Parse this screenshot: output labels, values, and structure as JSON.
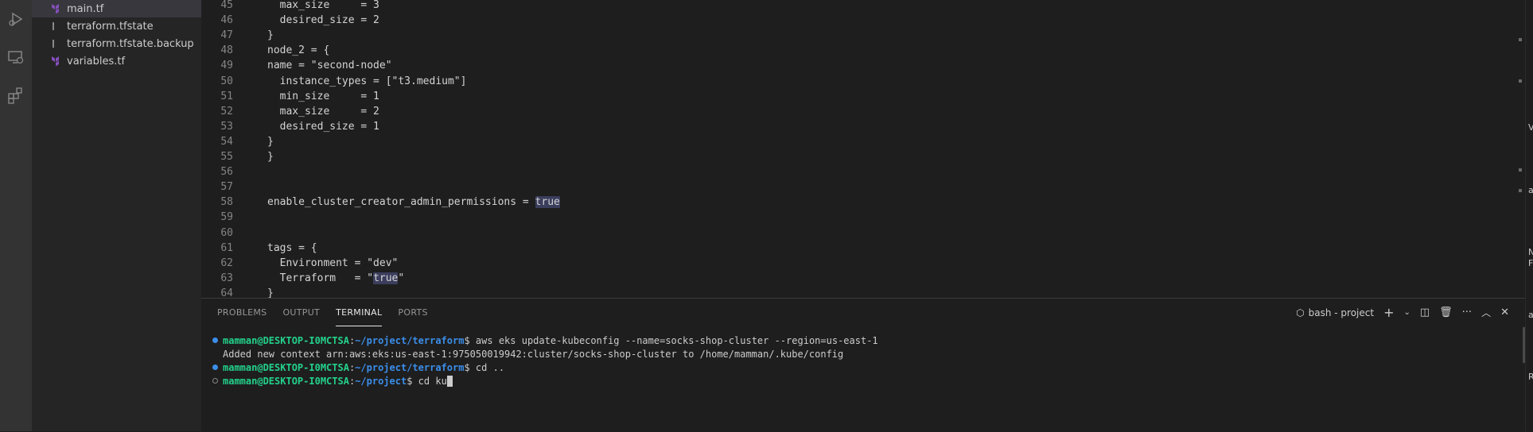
{
  "files": [
    {
      "name": "main.tf",
      "icon": "terraform-icon",
      "active": true
    },
    {
      "name": "terraform.tfstate",
      "icon": "file-lines-icon",
      "active": false
    },
    {
      "name": "terraform.tfstate.backup",
      "icon": "file-lines-icon",
      "active": false
    },
    {
      "name": "variables.tf",
      "icon": "terraform-icon",
      "active": false
    }
  ],
  "editor": {
    "lines": [
      {
        "n": "45",
        "text": "  max_size     = 3"
      },
      {
        "n": "46",
        "text": "  desired_size = 2"
      },
      {
        "n": "47",
        "text": "}"
      },
      {
        "n": "48",
        "text": "node_2 = {"
      },
      {
        "n": "49",
        "text": "name = \"second-node\""
      },
      {
        "n": "50",
        "text": "  instance_types = [\"t3.medium\"]"
      },
      {
        "n": "51",
        "text": "  min_size     = 1"
      },
      {
        "n": "52",
        "text": "  max_size     = 2"
      },
      {
        "n": "53",
        "text": "  desired_size = 1"
      },
      {
        "n": "54",
        "text": "}"
      },
      {
        "n": "55",
        "text": "}"
      },
      {
        "n": "56",
        "text": ""
      },
      {
        "n": "57",
        "text": ""
      },
      {
        "n": "58",
        "text": "enable_cluster_creator_admin_permissions = ",
        "hl": "true"
      },
      {
        "n": "59",
        "text": ""
      },
      {
        "n": "60",
        "text": ""
      },
      {
        "n": "61",
        "text": "tags = {"
      },
      {
        "n": "62",
        "text": "  Environment = \"dev\""
      },
      {
        "n": "63",
        "text": "  Terraform   = \"",
        "hl": "true",
        "after": "\""
      },
      {
        "n": "64",
        "text": "}"
      }
    ]
  },
  "panel": {
    "tabs": [
      "PROBLEMS",
      "OUTPUT",
      "TERMINAL",
      "PORTS"
    ],
    "active_tab": "TERMINAL",
    "terminal_name": "bash - project"
  },
  "terminal": {
    "lines": [
      {
        "user": "mamman@DESKTOP-I0MCTSA",
        "path": "~/project/terraform",
        "cmd": " aws eks update-kubeconfig --name=socks-shop-cluster --region=us-east-1",
        "dot": "#3b8eea"
      },
      {
        "output": "Added new context arn:aws:eks:us-east-1:975050019942:cluster/socks-shop-cluster to /home/mamman/.kube/config"
      },
      {
        "user": "mamman@DESKTOP-I0MCTSA",
        "path": "~/project/terraform",
        "cmd": " cd ..",
        "dot": "#3b8eea"
      },
      {
        "user": "mamman@DESKTOP-I0MCTSA",
        "path": "~/project",
        "cmd": " cd ku",
        "dot": "hollow",
        "cursor": true
      }
    ]
  },
  "rightstrip": [
    "V",
    "a",
    "N",
    "F",
    "av",
    "Re"
  ],
  "colors": {
    "accent": "#007acc",
    "keyword_hl": "#3a3d5c"
  }
}
